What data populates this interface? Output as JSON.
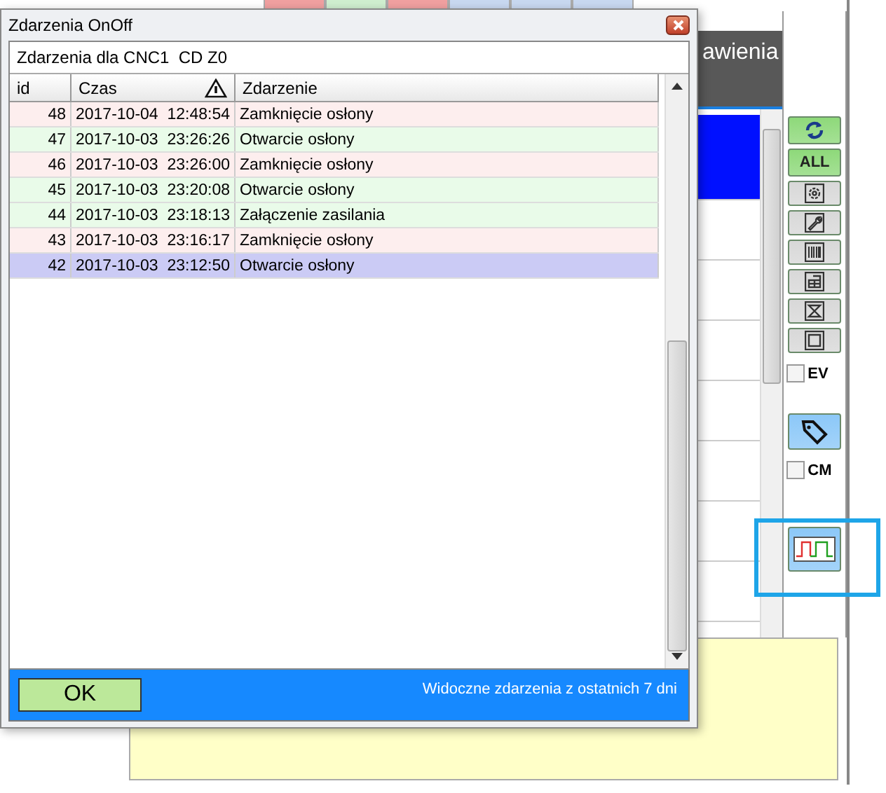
{
  "background": {
    "header_text": "awienia",
    "list_rows": [
      {
        "selected": true
      },
      {
        "selected": false
      },
      {
        "selected": false
      },
      {
        "selected": false
      },
      {
        "selected": false
      },
      {
        "selected": false
      },
      {
        "selected": false
      },
      {
        "selected": false
      }
    ],
    "toolbar": [
      {
        "kind": "refresh",
        "color": "#8ed97a"
      },
      {
        "kind": "text",
        "label": "ALL",
        "color": "#8ed97a"
      },
      {
        "kind": "gear",
        "color": "#d8d8d8"
      },
      {
        "kind": "wrench",
        "color": "#d8d8d8"
      },
      {
        "kind": "barcode",
        "color": "#d8d8d8"
      },
      {
        "kind": "table",
        "color": "#d8d8d8"
      },
      {
        "kind": "hourglass",
        "color": "#d8d8d8"
      },
      {
        "kind": "square",
        "color": "#d8d8d8"
      },
      {
        "kind": "checkbox",
        "label": "EV",
        "checked": false
      },
      {
        "kind": "tag",
        "color": "#8cc8f8"
      },
      {
        "kind": "checkbox",
        "label": "CM",
        "checked": false
      },
      {
        "kind": "chart",
        "color": "#8cc8f8",
        "highlighted": true
      }
    ]
  },
  "dialog": {
    "title": "Zdarzenia OnOff",
    "subtitle": "Zdarzenia dla CNC1  CD Z0",
    "columns": [
      "id",
      "Czas",
      "Zdarzenie"
    ],
    "rows": [
      {
        "id": "48",
        "time": "2017-10-04  12:48:54",
        "event": "Zamknięcie osłony",
        "kind": "close",
        "selected": false
      },
      {
        "id": "47",
        "time": "2017-10-03  23:26:26",
        "event": "Otwarcie osłony",
        "kind": "open",
        "selected": false
      },
      {
        "id": "46",
        "time": "2017-10-03  23:26:00",
        "event": "Zamknięcie osłony",
        "kind": "close",
        "selected": false
      },
      {
        "id": "45",
        "time": "2017-10-03  23:20:08",
        "event": "Otwarcie osłony",
        "kind": "open",
        "selected": false
      },
      {
        "id": "44",
        "time": "2017-10-03  23:18:13",
        "event": "Załączenie zasilania",
        "kind": "open",
        "selected": false
      },
      {
        "id": "43",
        "time": "2017-10-03  23:16:17",
        "event": "Zamknięcie osłony",
        "kind": "close",
        "selected": false
      },
      {
        "id": "42",
        "time": "2017-10-03  23:12:50",
        "event": "Otwarcie osłony",
        "kind": "open",
        "selected": true
      }
    ],
    "ok": "OK",
    "footer_note": "Widoczne zdarzenia z ostatnich 7 dni"
  }
}
